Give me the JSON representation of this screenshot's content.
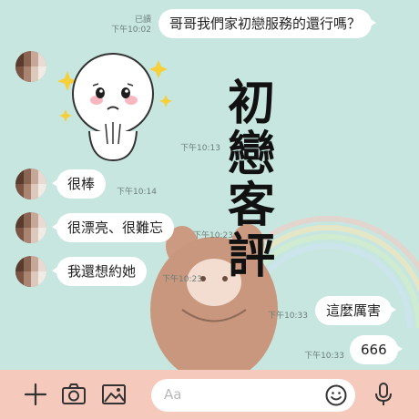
{
  "messages": [
    {
      "side": "out",
      "text": "哥哥我們家初戀服務的還行嗎？",
      "status": "已讀",
      "time": "下午10:02"
    },
    {
      "side": "in",
      "type": "sticker",
      "sticker_icon": "praying-round-face-sticker",
      "time": "下午10:13"
    },
    {
      "side": "in",
      "text": "很棒",
      "time": "下午10:14"
    },
    {
      "side": "in",
      "text": "很漂亮、很難忘",
      "time": "下午10:23"
    },
    {
      "side": "in",
      "text": "我還想約她",
      "time": "下午10:23"
    },
    {
      "side": "out",
      "text": "這麼厲害",
      "time": "下午10:33"
    },
    {
      "side": "out",
      "text": "666",
      "time": "下午10:33"
    }
  ],
  "overlay": {
    "chars": [
      "初",
      "戀",
      "客",
      "評"
    ]
  },
  "composer": {
    "placeholder": "Aa",
    "icons": [
      "plus-icon",
      "camera-icon",
      "image-icon",
      "emoji-icon",
      "microphone-icon"
    ]
  },
  "colors": {
    "chat_bg": "#c7e6df",
    "bubble": "#ffffff",
    "bottom_bar": "#f6c9bd"
  }
}
